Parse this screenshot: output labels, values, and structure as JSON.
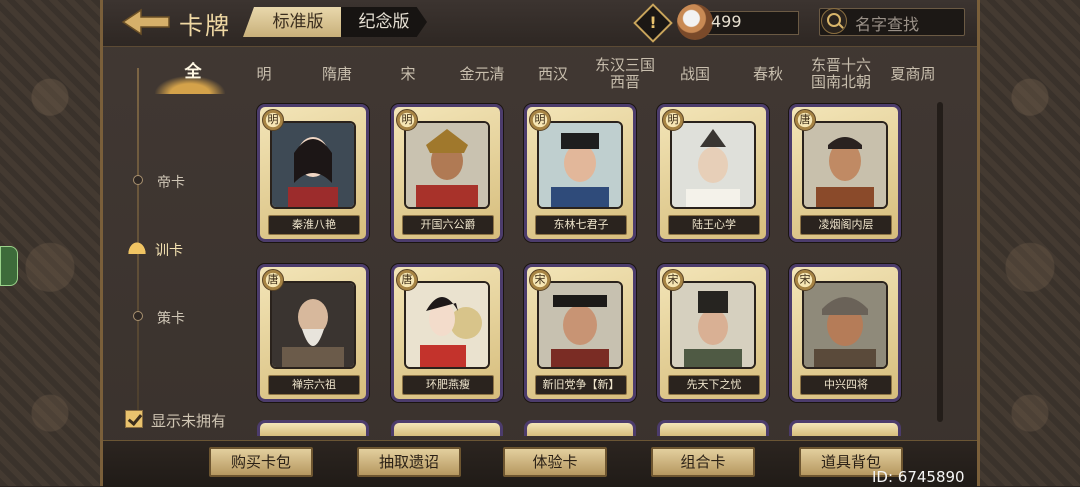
{
  "header": {
    "title": "卡牌",
    "tabs": [
      {
        "label": "标准版",
        "active": true
      },
      {
        "label": "纪念版",
        "active": false
      }
    ],
    "currency_value": "499",
    "search_placeholder": "名字查找"
  },
  "dynasty_filters": [
    {
      "label": "全",
      "active": true
    },
    {
      "label": "明"
    },
    {
      "label": "隋唐"
    },
    {
      "label": "宋"
    },
    {
      "label": "金元清"
    },
    {
      "label": "西汉"
    },
    {
      "label": "东汉三国\n西晋"
    },
    {
      "label": "战国"
    },
    {
      "label": "春秋"
    },
    {
      "label": "东晋十六\n国南北朝"
    },
    {
      "label": "夏商周"
    }
  ],
  "categories": [
    {
      "label": "帝卡",
      "active": false
    },
    {
      "label": "训卡",
      "active": true
    },
    {
      "label": "策卡",
      "active": false
    }
  ],
  "show_unowned": {
    "label": "显示未拥有",
    "checked": true
  },
  "cards": [
    {
      "badge": "明",
      "name": "秦淮八艳"
    },
    {
      "badge": "明",
      "name": "开国六公爵"
    },
    {
      "badge": "明",
      "name": "东林七君子"
    },
    {
      "badge": "明",
      "name": "陆王心学"
    },
    {
      "badge": "唐",
      "name": "凌烟阁内层"
    },
    {
      "badge": "唐",
      "name": "禅宗六祖"
    },
    {
      "badge": "唐",
      "name": "环肥燕瘦"
    },
    {
      "badge": "宋",
      "name": "新旧党争【新】"
    },
    {
      "badge": "宋",
      "name": "先天下之忧"
    },
    {
      "badge": "宋",
      "name": "中兴四将"
    }
  ],
  "bottom_buttons": [
    {
      "label": "购买卡包"
    },
    {
      "label": "抽取遗诏"
    },
    {
      "label": "体验卡"
    },
    {
      "label": "组合卡"
    },
    {
      "label": "道具背包"
    }
  ],
  "player_id": "ID: 6745890",
  "colors": {
    "accent_gold": "#e9c36e",
    "card_frame": "#4c3c6c",
    "panel_bg": "#3a322d"
  }
}
